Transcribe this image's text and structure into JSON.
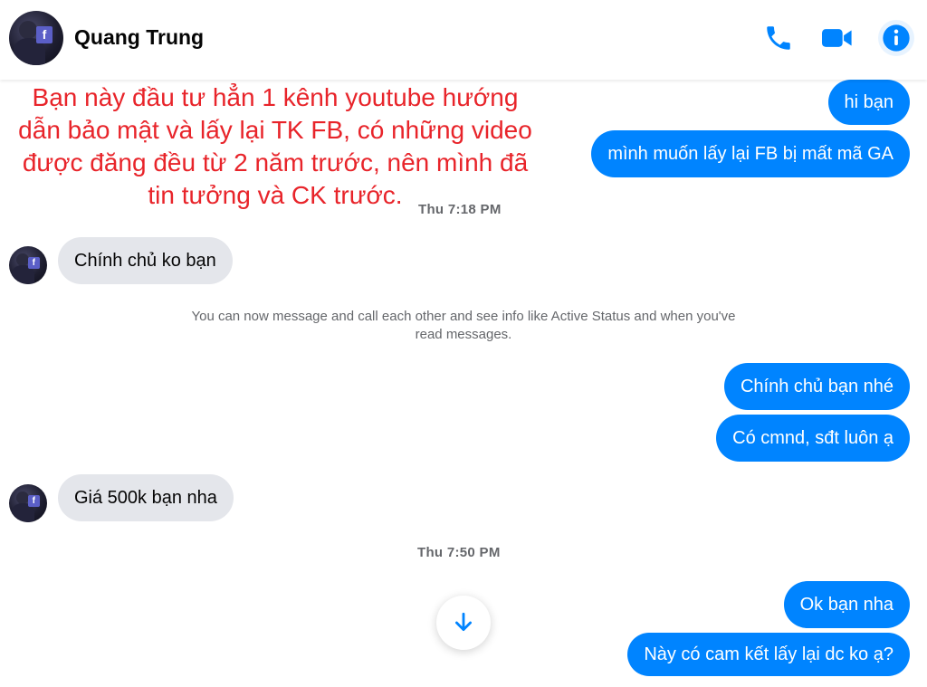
{
  "header": {
    "contact_name": "Quang Trung"
  },
  "overlay_text": "Bạn này đầu tư hẳn 1 kênh youtube hướng dẫn bảo mật và lấy lại TK FB, có những video được đăng đều từ 2 năm trước, nên mình đã tin tưởng và CK trước.",
  "messages": {
    "m1": "hi bạn",
    "m2": "mình muốn lấy lại FB bị mất mã GA",
    "time1": "Thu 7:18 PM",
    "m3": "Chính chủ ko bạn",
    "system_note": "You can now message and call each other and see info like Active Status and when you've read messages.",
    "m4": "Chính chủ bạn nhé",
    "m5": "Có cmnd, sđt luôn ạ",
    "m6": "Giá 500k bạn nha",
    "time2": "Thu 7:50 PM",
    "m7": "Ok bạn nha",
    "m8": "Này có cam kết lấy lại dc ko ạ?"
  },
  "colors": {
    "accent": "#0084ff",
    "incoming_bubble": "#e4e6eb",
    "overlay_text": "#e8242a"
  }
}
